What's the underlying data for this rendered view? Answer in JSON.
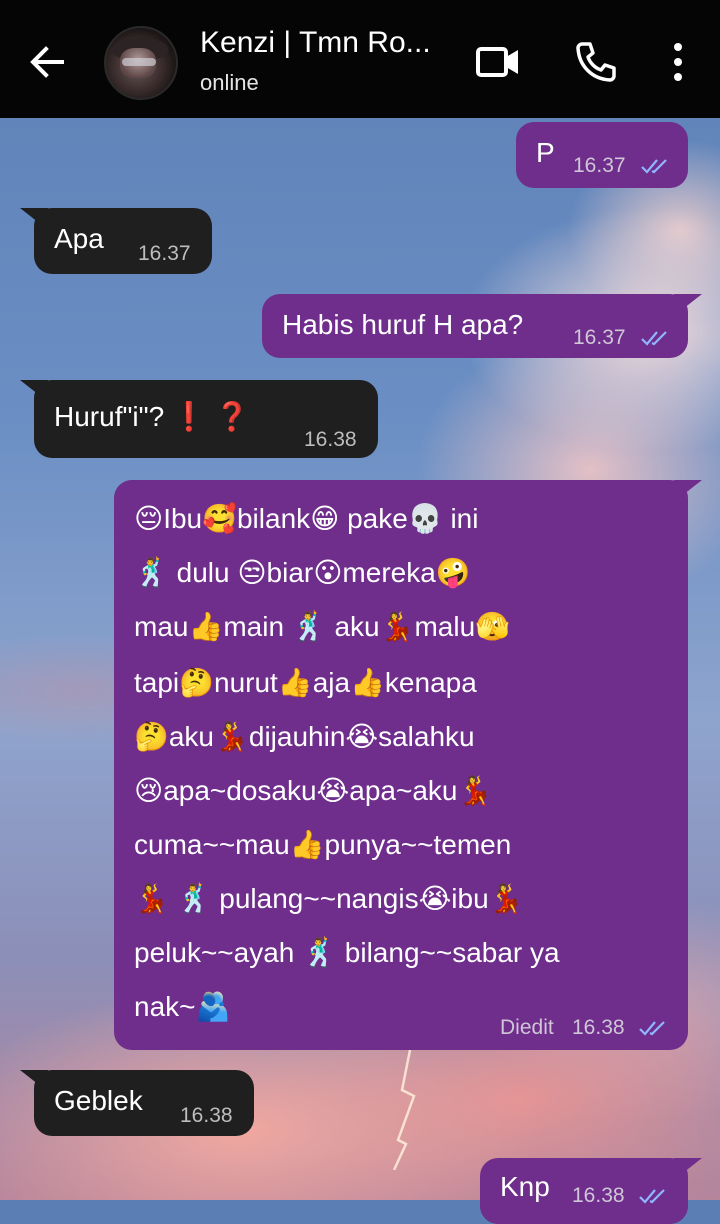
{
  "header": {
    "contact_name": "Kenzi | Tmn Ro...",
    "status": "online",
    "icons": [
      "back-arrow-icon",
      "video-call-icon",
      "phone-icon",
      "more-vert-icon"
    ]
  },
  "messages": [
    {
      "dir": "out",
      "text": "P",
      "time": "16.37",
      "ticks": "double-check-read"
    },
    {
      "dir": "in",
      "text": "Apa",
      "time": "16.37"
    },
    {
      "dir": "out",
      "text": "Habis huruf H apa?",
      "time": "16.37",
      "ticks": "double-check-read"
    },
    {
      "dir": "in",
      "text": "Huruf\"i\"? ❗ ❓",
      "time": "16.38"
    },
    {
      "dir": "out",
      "lines": [
        "😔Ibu🥰bilank😁 pake💀 ini",
        "🕺 dulu 😒biar😮mereka🤪",
        "mau👍main 🕺 aku💃malu🫣",
        "tapi🤔nurut👍aja👍kenapa",
        "🤔aku💃dijauhin😭salahku",
        "😢apa~dosaku😭apa~aku💃",
        "cuma~~mau👍punya~~temen",
        "💃 🕺  pulang~~nangis😭ibu💃",
        "peluk~~ayah 🕺 bilang~~sabar ya",
        "nak~🫂"
      ],
      "edited_label": "Diedit",
      "time": "16.38",
      "ticks": "double-check-read"
    },
    {
      "dir": "in",
      "text": "Geblek",
      "time": "16.38"
    },
    {
      "dir": "out",
      "text": "Knp",
      "time": "16.38",
      "ticks": "double-check-read"
    }
  ],
  "colors": {
    "header_bg": "#050505",
    "incoming_bubble": "#1f1f1f",
    "outgoing_bubble": "#6f2d8c",
    "read_ticks": "#8fb6ff"
  }
}
